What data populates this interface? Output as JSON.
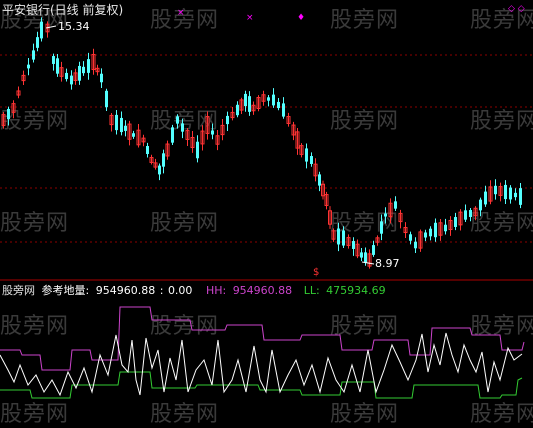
{
  "title": "平安银行(日线 前复权)",
  "watermark": "股旁网",
  "price_panel": {
    "high_label": "15.34",
    "low_label": "8.97",
    "top_marks": [
      "×",
      "×",
      "♦",
      "◇ ◇"
    ],
    "dividend_mark": "$"
  },
  "indicator_panel": {
    "name": "股旁网",
    "series_name": "参考地量:",
    "value": "954960.88",
    "value2": "0.00",
    "hh_label": "HH:",
    "hh_value": "954960.88",
    "ll_label": "LL:",
    "ll_value": "475934.69"
  },
  "colors": {
    "up": "#ff3333",
    "down": "#54ffff",
    "hh": "#cc44cc",
    "ll": "#33cc33",
    "line": "#ffffff",
    "grid": "#8b0000"
  }
}
